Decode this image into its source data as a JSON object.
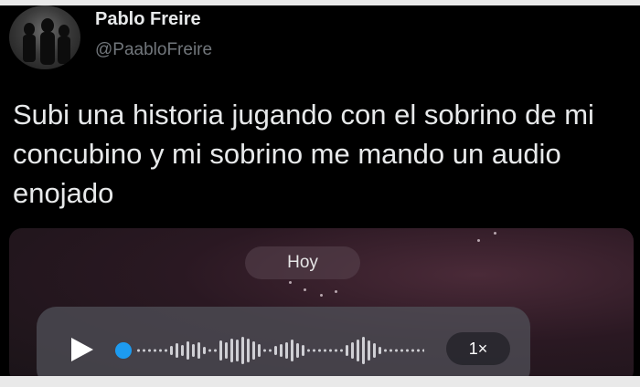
{
  "tweet": {
    "author_name": "Pablo Freire",
    "handle": "@PaabloFreire",
    "more_label": "···",
    "text": "Subi una historia jugando con el sobrino de mi concubino y mi sobrino me mando un audio enojado"
  },
  "media": {
    "date_label": "Hoy",
    "audio": {
      "speed_label": "1×",
      "progress": 0,
      "play_icon": "play-icon"
    }
  },
  "colors": {
    "background": "#000000",
    "text": "#e7e9ea",
    "secondary_text": "#71767b",
    "progress_dot": "#1d9bf0"
  }
}
